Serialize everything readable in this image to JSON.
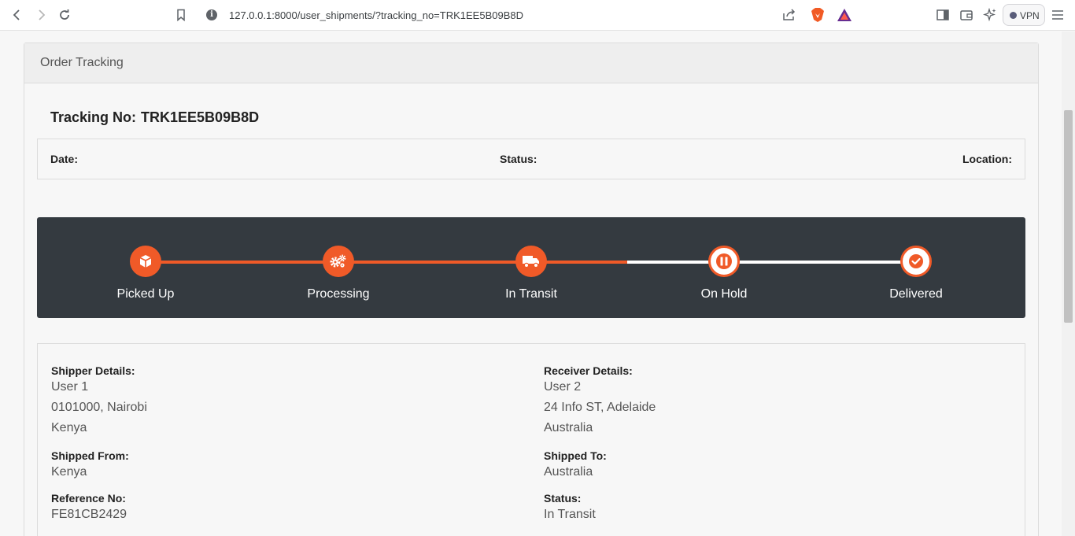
{
  "browser": {
    "url": "127.0.0.1:8000/user_shipments/?tracking_no=TRK1EE5B09B8D",
    "vpn_label": "VPN"
  },
  "card": {
    "header_title": "Order Tracking",
    "tracking_label": "Tracking No:",
    "tracking_no": "TRK1EE5B09B8D",
    "date_label": "Date:",
    "status_label": "Status:",
    "location_label": "Location:"
  },
  "progress": {
    "accent": "#f05a28",
    "completed_segments": 2.5,
    "steps": [
      {
        "label": "Picked Up",
        "icon": "box-icon",
        "state": "done"
      },
      {
        "label": "Processing",
        "icon": "gears-icon",
        "state": "done"
      },
      {
        "label": "In Transit",
        "icon": "truck-icon",
        "state": "done"
      },
      {
        "label": "On Hold",
        "icon": "pause-icon",
        "state": "pending"
      },
      {
        "label": "Delivered",
        "icon": "check-circle-icon",
        "state": "pending"
      }
    ]
  },
  "details": {
    "shipper": {
      "label": "Shipper Details:",
      "name": "User 1",
      "address": "0101000, Nairobi",
      "country": "Kenya"
    },
    "receiver": {
      "label": "Receiver Details:",
      "name": "User 2",
      "address": "24 Info ST, Adelaide",
      "country": "Australia"
    },
    "shipped_from": {
      "label": "Shipped From:",
      "value": "Kenya"
    },
    "shipped_to": {
      "label": "Shipped To:",
      "value": "Australia"
    },
    "reference": {
      "label": "Reference No:",
      "value": "FE81CB2429"
    },
    "status": {
      "label": "Status:",
      "value": "In Transit"
    }
  }
}
